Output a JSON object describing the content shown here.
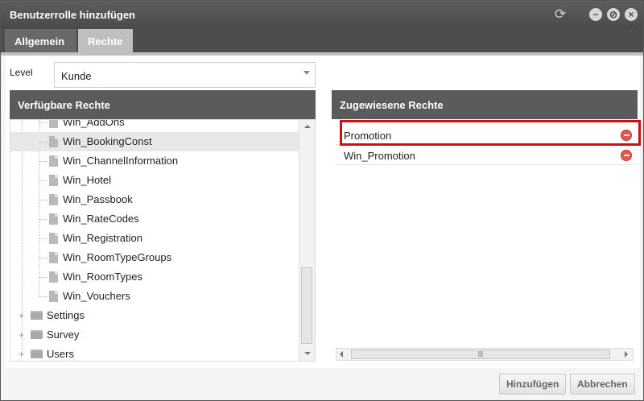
{
  "window": {
    "title": "Benutzerrolle hinzufügen"
  },
  "tabs": [
    {
      "label": "Allgemein"
    },
    {
      "label": "Rechte"
    }
  ],
  "level": {
    "label": "Level",
    "value": "Kunde"
  },
  "available": {
    "header": "Verfügbare Rechte",
    "partial_item": "Win_AddOns",
    "items": [
      {
        "label": "Win_BookingConst",
        "selected": true
      },
      {
        "label": "Win_ChannelInformation"
      },
      {
        "label": "Win_Hotel"
      },
      {
        "label": "Win_Passbook"
      },
      {
        "label": "Win_RateCodes"
      },
      {
        "label": "Win_Registration"
      },
      {
        "label": "Win_RoomTypeGroups"
      },
      {
        "label": "Win_RoomTypes"
      },
      {
        "label": "Win_Vouchers"
      }
    ],
    "folders": [
      {
        "label": "Settings"
      },
      {
        "label": "Survey"
      },
      {
        "label": "Users"
      }
    ]
  },
  "assigned": {
    "header": "Zugewiesene Rechte",
    "items": [
      {
        "label": "Promotion"
      },
      {
        "label": "Win_Promotion"
      }
    ]
  },
  "buttons": {
    "add": "Hinzufügen",
    "cancel": "Abbrechen"
  },
  "colors": {
    "titlebar": "#4a4a4a",
    "highlight": "#cc1111",
    "remove": "#e3584f"
  }
}
